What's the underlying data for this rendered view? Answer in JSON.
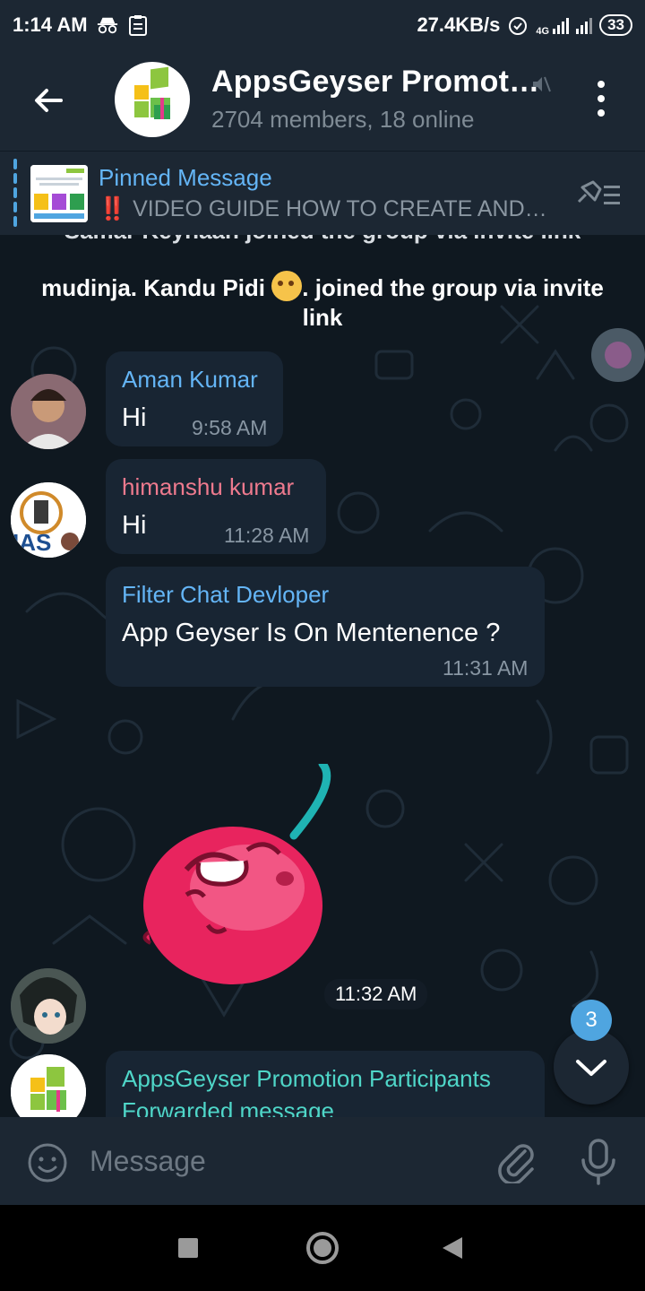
{
  "status_bar": {
    "time": "1:14 AM",
    "speed": "27.4KB/s",
    "network": "4G",
    "battery": "33"
  },
  "header": {
    "title": "AppsGeyser Promot…",
    "subtitle": "2704 members, 18 online"
  },
  "pinned": {
    "title": "Pinned Message",
    "text": "VIDEO GUIDE HOW TO CREATE AND…",
    "prefix": "‼️"
  },
  "system_messages": {
    "cut_off": "Samar Keyhaan joined the group via invite link",
    "joined_before": "mudinja. Kandu Pidi",
    "joined_after": ". joined the group via invite link"
  },
  "messages": [
    {
      "sender": "Aman Kumar",
      "text": "Hi",
      "time": "9:58 AM",
      "name_color": "#64b5f6"
    },
    {
      "sender": "himanshu kumar",
      "text": "Hi",
      "time": "11:28 AM",
      "name_color": "#ee7a8e"
    },
    {
      "sender": "Filter Chat Devloper",
      "text": "App Geyser Is On Mentenence ?",
      "time": "11:31 AM",
      "name_color": "#64b5f6"
    }
  ],
  "sticker": {
    "time": "11:32 AM"
  },
  "forwarded": {
    "sender": "AppsGeyser Promotion Participants",
    "label": "Forwarded message",
    "name_color": "#4fd6c8"
  },
  "scroll": {
    "unread_count": "3"
  },
  "input": {
    "placeholder": "Message"
  },
  "avatars": {
    "ias_label": "IAS"
  }
}
